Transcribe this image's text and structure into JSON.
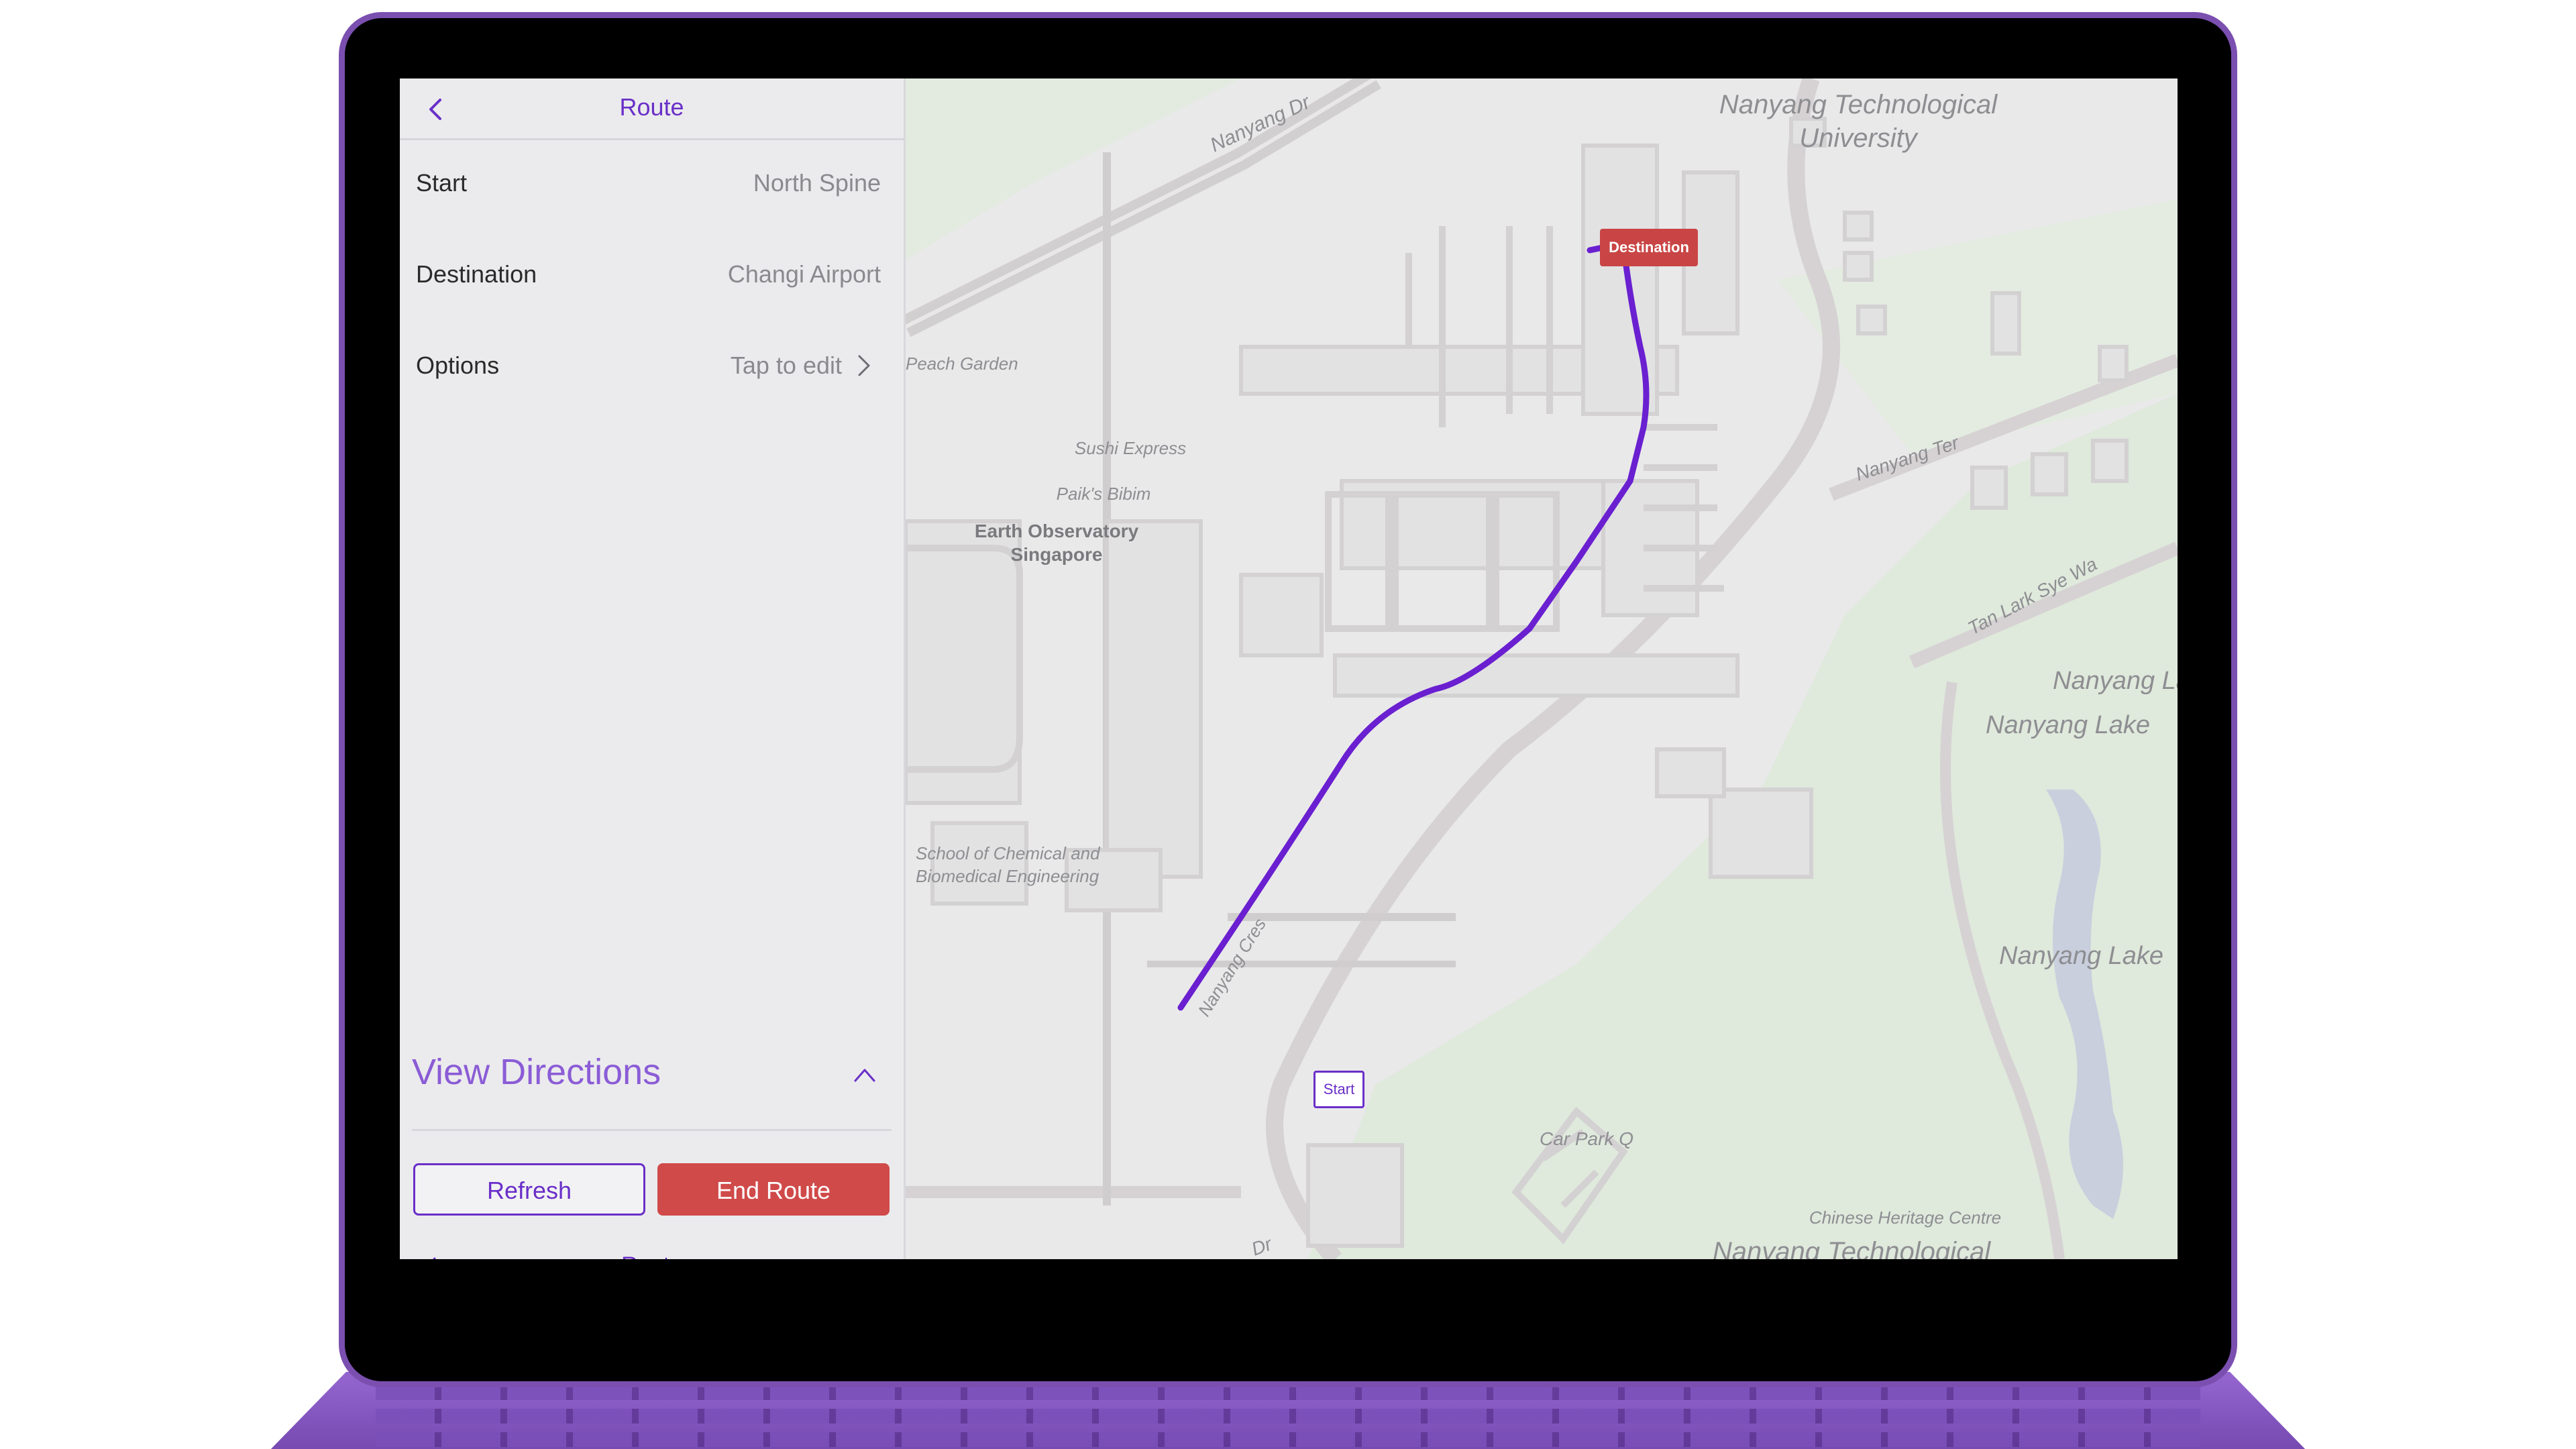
{
  "app": {
    "nav_title": "Route"
  },
  "route_form": {
    "start_label": "Start",
    "start_value": "North Spine",
    "destination_label": "Destination",
    "destination_value": "Changi Airport",
    "options_label": "Options",
    "options_value": "Tap to edit"
  },
  "directions": {
    "label": "View Directions"
  },
  "actions": {
    "refresh_label": "Refresh",
    "end_route_label": "End Route"
  },
  "peek": {
    "title": "Route"
  },
  "map": {
    "labels": {
      "nanyang_dr": "Nanyang Dr",
      "ntu_line1": "Nanyang Technological",
      "ntu_line2": "University",
      "peach_garden": "Peach Garden",
      "sushi_express": "Sushi Express",
      "paiks_bibim": "Paik's Bibim",
      "eos_line1": "Earth Observatory",
      "eos_line2": "Singapore",
      "scbe_line1": "School of Chemical and",
      "scbe_line2": "Biomedical Engineering",
      "nanyang_ter": "Nanyang Ter",
      "tan_lark_sye": "Tan Lark Sye Wa",
      "nanyang_lake_1": "Nanyang Lake",
      "nanyang_lake_2": "Nanyang Lake",
      "nanyang_lake_3": "Nanyang Lake",
      "nanyang_cres": "Nanyang Cres",
      "car_park": "Car Park Q",
      "chinese_heritage": "Chinese Heritage Centre",
      "ntu_bottom": "Nanyang Technological",
      "nanyang_dr_bottom": "Dr"
    },
    "markers": {
      "start": "Start",
      "destination": "Destination"
    }
  },
  "colors": {
    "accent": "#6a2fc8",
    "danger": "#d04a4a",
    "route_line": "#6a1fd0"
  }
}
